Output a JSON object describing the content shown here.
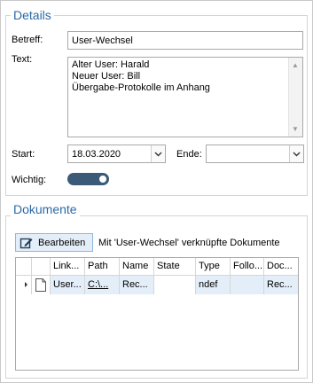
{
  "details": {
    "legend": "Details",
    "betreff_label": "Betreff:",
    "betreff_value": "User-Wechsel",
    "text_label": "Text:",
    "text_lines": [
      "Alter User: Harald",
      "Neuer User: Bill",
      "Übergabe-Protokolle im Anhang"
    ],
    "start_label": "Start:",
    "start_value": "18.03.2020",
    "ende_label": "Ende:",
    "ende_value": "",
    "wichtig_label": "Wichtig:",
    "wichtig_on": true
  },
  "dokumente": {
    "legend": "Dokumente",
    "edit_button_label": "Bearbeiten",
    "caption": "Mit 'User-Wechsel' verknüpfte Dokumente",
    "columns": [
      "Link...",
      "Path",
      "Name",
      "State",
      "Type",
      "Follo...",
      "Doc..."
    ],
    "rows": [
      {
        "link": "User...",
        "path": "C:\\...",
        "name": "Rec...",
        "state": "",
        "type": "ndef",
        "follow": "",
        "doc": "Rec..."
      }
    ]
  },
  "colors": {
    "accent": "#2b6aa8",
    "toggle": "#3a5a78",
    "selected_row": "#e3eef9"
  },
  "icons": {
    "edit_button": "edit-icon",
    "dropdown": "chevron-down-icon",
    "document": "document-icon",
    "row_indicator": "row-pointer-icon"
  }
}
